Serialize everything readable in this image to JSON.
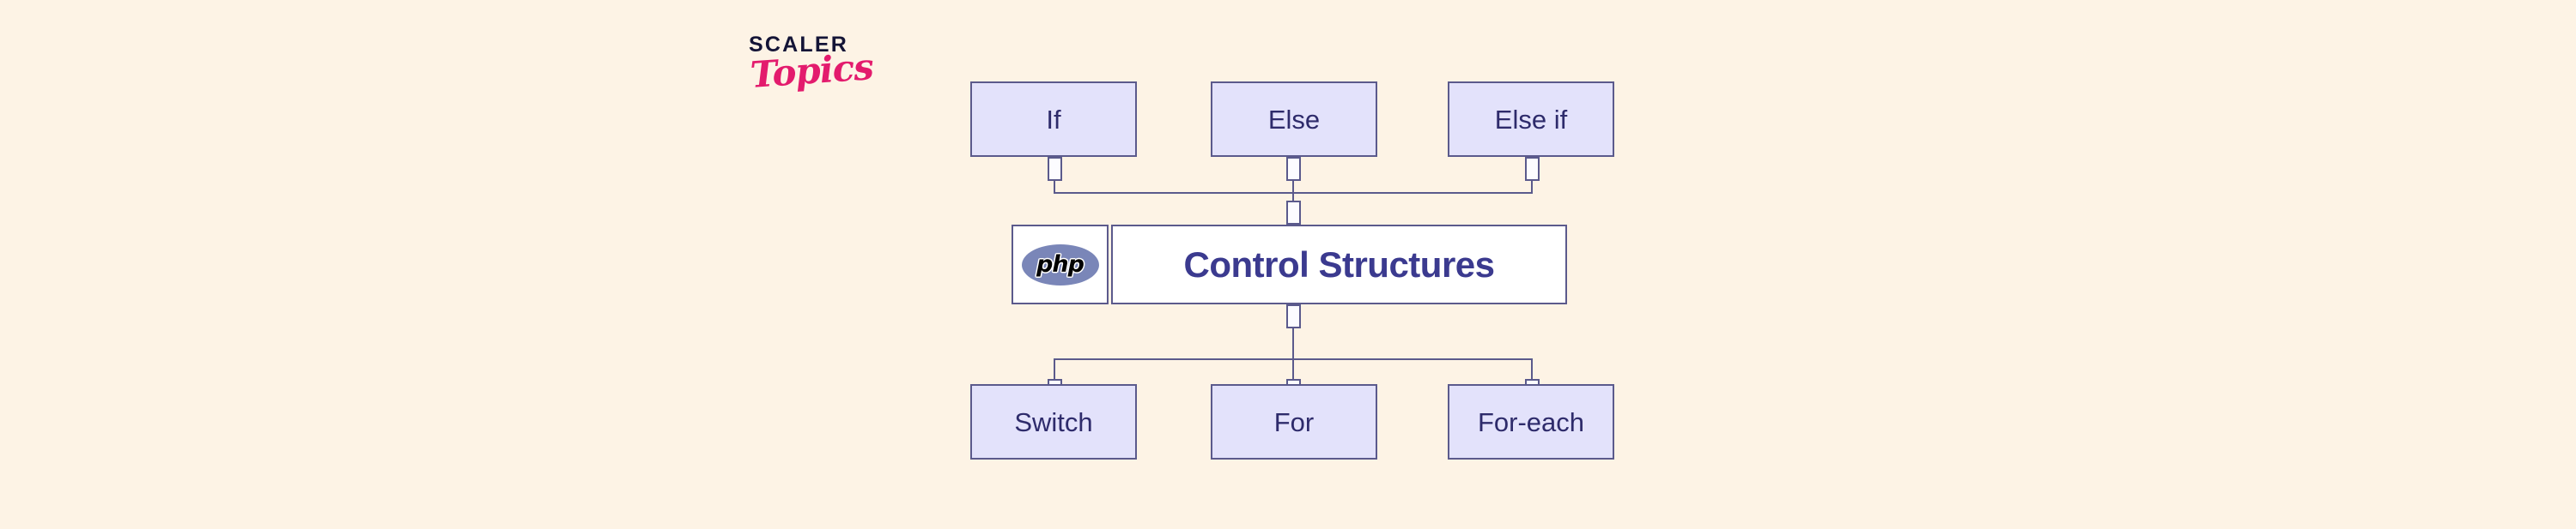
{
  "brand": {
    "name": "SCALER",
    "tagline": "Topics",
    "name_color": "#141436",
    "tagline_color": "#e31b6d"
  },
  "diagram": {
    "background_color": "#fdf3e5",
    "node_fill": "#e3e2fb",
    "node_border": "#5b5a8c",
    "node_text_color": "#2e2b6b",
    "center_fill": "#ffffff",
    "center_text_color": "#3b3a8f",
    "center": {
      "title": "Control Structures",
      "logo_text": "php",
      "logo_color": "#7a86b8"
    },
    "top_nodes": [
      {
        "label": "If"
      },
      {
        "label": "Else"
      },
      {
        "label": "Else if"
      }
    ],
    "bottom_nodes": [
      {
        "label": "Switch"
      },
      {
        "label": "For"
      },
      {
        "label": "For-each"
      }
    ]
  }
}
